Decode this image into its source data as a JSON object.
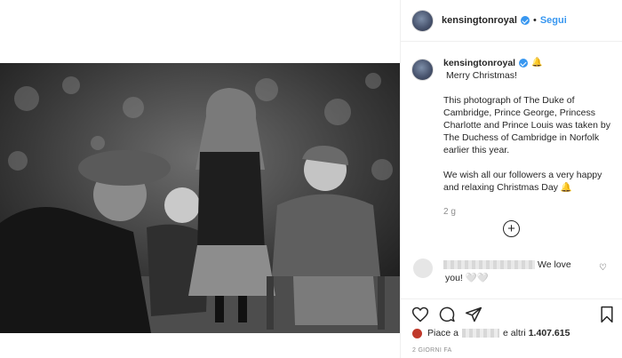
{
  "post": {
    "username": "kensingtonroyal",
    "follow_label": "Segui",
    "separator": "•",
    "caption_emoji": "🔔",
    "caption_greeting": "Merry Christmas!",
    "caption_paragraph_1": "This photograph of The Duke of Cambridge, Prince George, Princess Charlotte and Prince Louis was taken by The Duchess of Cambridge in Norfolk earlier this year.",
    "caption_paragraph_2": "We wish all our followers a very happy and relaxing Christmas Day 🔔",
    "caption_time": "2 g",
    "load_more_symbol": "+"
  },
  "comment": {
    "text_part_1": "We love",
    "text_part_2": "you! 🤍🤍",
    "like_symbol": "♡"
  },
  "likes": {
    "prefix": "Piace a",
    "middle": "e altri",
    "count": "1.407.615"
  },
  "time_ago": "2 GIORNI FA",
  "icons": [
    "verified-badge-icon",
    "bell-icon",
    "plus-circle-icon",
    "heart-icon",
    "comment-icon",
    "share-icon",
    "bookmark-icon"
  ],
  "colors": {
    "link": "#3897f0",
    "text": "#262626",
    "muted": "#8e8e8e",
    "border": "#efefef"
  }
}
